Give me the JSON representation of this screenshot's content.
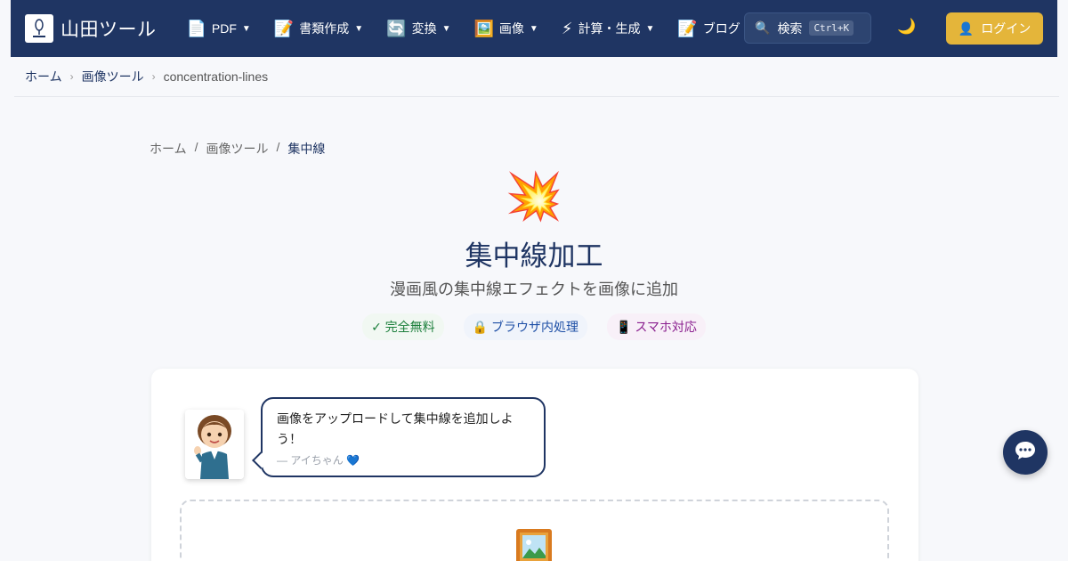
{
  "header": {
    "site_name": "山田ツール",
    "nav": [
      {
        "icon": "document-icon",
        "emoji": "📄",
        "label": "PDF",
        "dropdown": "▼"
      },
      {
        "icon": "memo-icon",
        "emoji": "📝",
        "label": "書類作成",
        "dropdown": "▼"
      },
      {
        "icon": "convert-icon",
        "emoji": "🔄",
        "label": "変換",
        "dropdown": "▼"
      },
      {
        "icon": "picture-icon",
        "emoji": "🖼️",
        "label": "画像",
        "dropdown": "▼"
      },
      {
        "icon": "lightning-icon",
        "emoji": "⚡",
        "label": "計算・生成",
        "dropdown": "▼"
      },
      {
        "icon": "memo-icon",
        "emoji": "📝",
        "label": "ブログ",
        "dropdown": ""
      }
    ],
    "search": {
      "emoji": "🔍",
      "label": "検索",
      "shortcut": "Ctrl+K"
    },
    "theme_toggle": "🌙",
    "login": {
      "emoji": "👤",
      "label": "ログイン"
    }
  },
  "breadcrumb_top": {
    "home": "ホーム",
    "category": "画像ツール",
    "current": "concentration-lines",
    "sep": "›"
  },
  "breadcrumb_inner": {
    "home": "ホーム",
    "category": "画像ツール",
    "current": "集中線",
    "sep": "/"
  },
  "hero": {
    "icon": "💥",
    "title": "集中線加工",
    "subtitle": "漫画風の集中線エフェクトを画像に追加",
    "badges": [
      "✓ 完全無料",
      "🔒 ブラウザ内処理",
      "📱 スマホ対応"
    ]
  },
  "assistant": {
    "message": "画像をアップロードして集中線を追加しよう！",
    "signature": "— アイちゃん 💙"
  },
  "colors": {
    "primary": "#1f3563",
    "accent": "#e4b53a",
    "background": "#f7f8fb"
  }
}
